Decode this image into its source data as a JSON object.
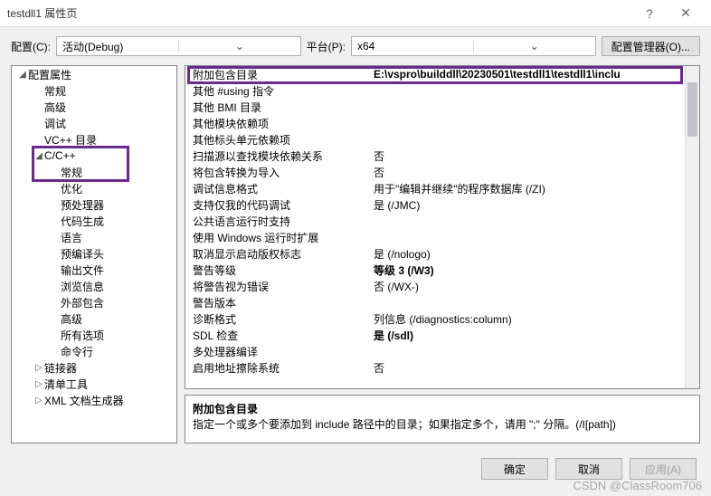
{
  "title": "testdll1 属性页",
  "top": {
    "config_label": "配置(C):",
    "config_value": "活动(Debug)",
    "platform_label": "平台(P):",
    "platform_value": "x64",
    "manager": "配置管理器(O)..."
  },
  "tree": {
    "root": "配置属性",
    "items1": [
      "常规",
      "高级",
      "调试",
      "VC++ 目录"
    ],
    "cpp": "C/C++",
    "cppItems": [
      "常规",
      "优化",
      "预处理器",
      "代码生成",
      "语言",
      "预编译头",
      "输出文件",
      "浏览信息",
      "外部包含",
      "高级",
      "所有选项",
      "命令行"
    ],
    "tail": [
      "链接器",
      "清单工具",
      "XML 文档生成器"
    ]
  },
  "grid": [
    {
      "n": "附加包含目录",
      "v": "E:\\vspro\\builddll\\20230501\\testdll1\\testdll1\\inclu",
      "b": true
    },
    {
      "n": "其他 #using 指令",
      "v": ""
    },
    {
      "n": "其他 BMI 目录",
      "v": ""
    },
    {
      "n": "其他模块依赖项",
      "v": ""
    },
    {
      "n": "其他标头单元依赖项",
      "v": ""
    },
    {
      "n": "扫描源以查找模块依赖关系",
      "v": "否"
    },
    {
      "n": "将包含转换为导入",
      "v": "否"
    },
    {
      "n": "调试信息格式",
      "v": "用于\"编辑并继续\"的程序数据库 (/ZI)"
    },
    {
      "n": "支持仅我的代码调试",
      "v": "是 (/JMC)"
    },
    {
      "n": "公共语言运行时支持",
      "v": ""
    },
    {
      "n": "使用 Windows 运行时扩展",
      "v": ""
    },
    {
      "n": "取消显示启动版权标志",
      "v": "是 (/nologo)"
    },
    {
      "n": "警告等级",
      "v": "等级 3 (/W3)",
      "b": true
    },
    {
      "n": "将警告视为错误",
      "v": "否 (/WX-)"
    },
    {
      "n": "警告版本",
      "v": ""
    },
    {
      "n": "诊断格式",
      "v": "列信息 (/diagnostics:column)"
    },
    {
      "n": "SDL 检查",
      "v": "是 (/sdl)",
      "b": true
    },
    {
      "n": "多处理器编译",
      "v": ""
    },
    {
      "n": "启用地址擦除系统",
      "v": "否"
    }
  ],
  "desc": {
    "title": "附加包含目录",
    "body": "指定一个或多个要添加到 include 路径中的目录；如果指定多个，请用 \";\" 分隔。(/I[path])"
  },
  "buttons": {
    "ok": "确定",
    "cancel": "取消",
    "apply": "应用(A)"
  },
  "watermark": "CSDN @ClassRoom706"
}
